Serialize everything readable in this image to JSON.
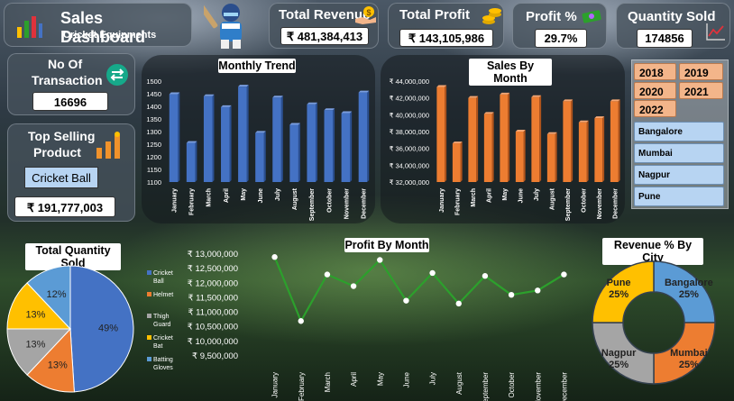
{
  "header": {
    "title": "Sales Dashboard",
    "subtitle": "Cricket Equipments"
  },
  "kpis": {
    "total_revenue": {
      "label": "Total Revenue",
      "value": "₹ 481,384,413"
    },
    "total_profit": {
      "label": "Total Profit",
      "value": "₹ 143,105,986"
    },
    "profit_pct": {
      "label": "Profit %",
      "value": "29.7%"
    },
    "quantity_sold": {
      "label": "Quantity Sold",
      "value": "174856"
    },
    "transactions": {
      "label_line1": "No Of",
      "label_line2": "Transaction",
      "value": "16696"
    },
    "top_product": {
      "label_line1": "Top Selling",
      "label_line2": "Product",
      "product": "Cricket Ball",
      "value": "₹ 191,777,003"
    }
  },
  "slicers": {
    "years": [
      "2018",
      "2019",
      "2020",
      "2021",
      "2022"
    ],
    "cities": [
      "Bangalore",
      "Mumbai",
      "Nagpur",
      "Pune"
    ]
  },
  "colors": {
    "blue": "#4472c4",
    "orange": "#ed7d31",
    "gray": "#a5a5a5",
    "yellow": "#ffc000",
    "lightblue": "#5b9bd5",
    "green": "#2ca02c"
  },
  "chart_data": [
    {
      "id": "monthly_trend",
      "type": "bar",
      "title": "Monthly Trend",
      "categories": [
        "January",
        "February",
        "March",
        "April",
        "May",
        "June",
        "July",
        "August",
        "September",
        "October",
        "November",
        "December"
      ],
      "values": [
        1448,
        1255,
        1440,
        1397,
        1478,
        1295,
        1435,
        1327,
        1408,
        1385,
        1373,
        1455
      ],
      "ylim": [
        1100,
        1500
      ],
      "yticks": [
        "1100",
        "1150",
        "1200",
        "1250",
        "1300",
        "1350",
        "1400",
        "1450",
        "1500"
      ]
    },
    {
      "id": "sales_by_month",
      "type": "bar",
      "title": "Sales By Month",
      "categories": [
        "January",
        "February",
        "March",
        "April",
        "May",
        "June",
        "July",
        "August",
        "September",
        "October",
        "November",
        "December"
      ],
      "values": [
        43300000,
        36600000,
        42000000,
        40100000,
        42400000,
        38000000,
        42100000,
        37700000,
        41600000,
        39100000,
        39600000,
        41600000
      ],
      "ylim": [
        32000000,
        44000000
      ],
      "yticks": [
        "₹ 32,000,000",
        "₹ 34,000,000",
        "₹ 36,000,000",
        "₹ 38,000,000",
        "₹ 40,000,000",
        "₹ 42,000,000",
        "₹ 44,000,000"
      ]
    },
    {
      "id": "total_quantity_sold",
      "type": "pie",
      "title": "Total Quantity Sold",
      "categories": [
        "Cricket Ball",
        "Helmet",
        "Thigh Guard",
        "Cricket Bat",
        "Batting Gloves"
      ],
      "values": [
        49,
        13,
        13,
        13,
        12
      ],
      "labels": [
        "49%",
        "13%",
        "13%",
        "13%",
        "12%"
      ],
      "legend": "left"
    },
    {
      "id": "profit_by_month",
      "type": "line",
      "title": "Profit By Month",
      "categories": [
        "January",
        "February",
        "March",
        "April",
        "May",
        "June",
        "July",
        "August",
        "September",
        "October",
        "November",
        "December"
      ],
      "values": [
        12900000,
        10700000,
        12300000,
        11900000,
        12800000,
        11400000,
        12350000,
        11300000,
        12250000,
        11600000,
        11750000,
        12300000
      ],
      "ylim": [
        9500000,
        13000000
      ],
      "yticks": [
        "₹ 9,500,000",
        "₹ 10,000,000",
        "₹ 10,500,000",
        "₹ 11,000,000",
        "₹ 11,500,000",
        "₹ 12,000,000",
        "₹ 12,500,000",
        "₹ 13,000,000"
      ]
    },
    {
      "id": "revenue_by_city",
      "type": "pie",
      "title": "Revenue % By City",
      "categories": [
        "Bangalore",
        "Mumbai",
        "Nagpur",
        "Pune"
      ],
      "values": [
        25,
        25,
        25,
        25
      ],
      "labels": [
        "Bangalore\n25%",
        "Mumbai\n25%",
        "Nagpur\n25%",
        "Pune\n25%"
      ]
    }
  ]
}
